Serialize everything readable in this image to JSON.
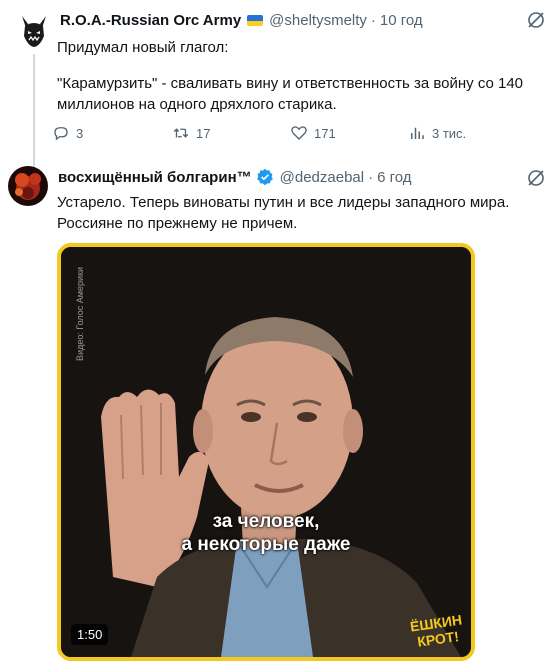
{
  "tweet1": {
    "name": "R.O.A.-Russian Orc Army",
    "handle": "@sheltysmelty",
    "separator": "·",
    "time": "10 год",
    "text_line1": "Придумал новый глагол:",
    "text_line2": "\"Карамурзить\" - сваливать вину и ответственность за войну со 140",
    "text_line3": "миллионов на одного дряхлого старика.",
    "actions": {
      "replies": "3",
      "reposts": "17",
      "likes": "171",
      "views": "3 тис."
    },
    "icons": {
      "avatar": "orc-face-icon",
      "flag": "ukraine-flag-icon",
      "grok": "grok-icon",
      "reply": "reply-icon",
      "repost": "repost-icon",
      "like": "heart-icon",
      "views": "views-icon"
    }
  },
  "tweet2": {
    "name": "восхищённый болгарин™",
    "handle": "@dedzaebal",
    "separator": "·",
    "time": "6 год",
    "text_line1": "Устарело. Теперь виноваты путин и все лидеры западного мира.",
    "text_line2": "Россияне по прежнему не причем.",
    "media": {
      "duration": "1:50",
      "subtitle_line1": "за человек,",
      "subtitle_line2": "а некоторые даже",
      "watermark": "Видео: Голос Америки",
      "logo_line1": "ЁШКИН",
      "logo_line2": "КРОТ!"
    },
    "colors": {
      "media_border": "#f3c81f",
      "verified": "#1d9bf0"
    }
  }
}
